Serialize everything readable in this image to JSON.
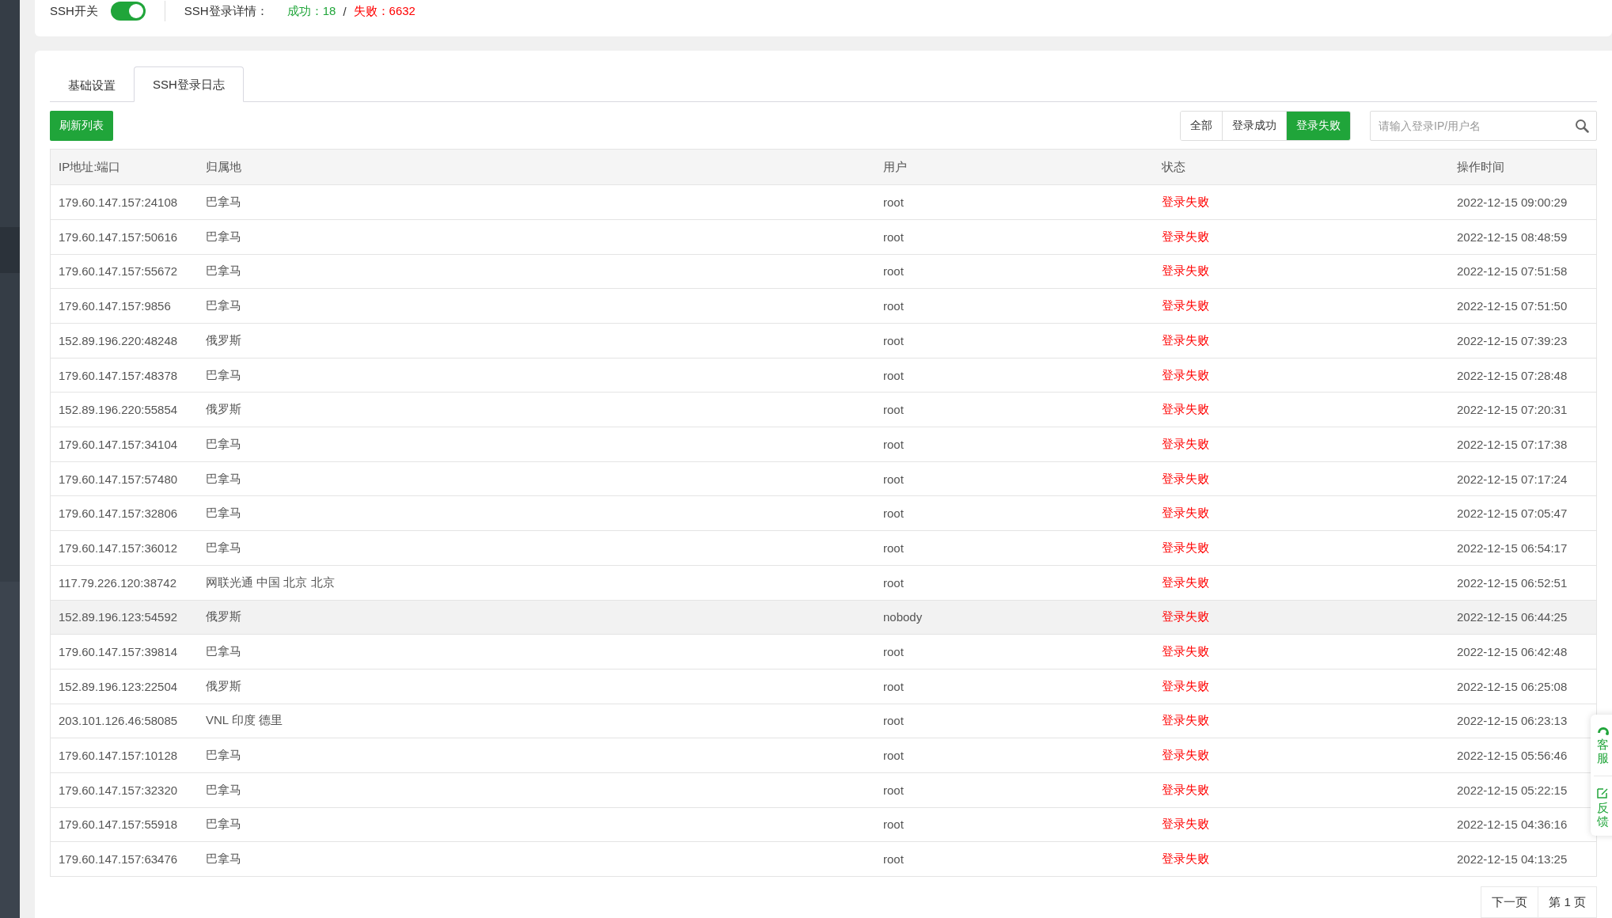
{
  "header": {
    "switch_label": "SSH开关",
    "switch_on": true,
    "details_label": "SSH登录详情：",
    "success": "成功：18",
    "separator": "/",
    "failure": "失败：6632"
  },
  "tabs": [
    {
      "label": "基础设置",
      "selected": false
    },
    {
      "label": "SSH登录日志",
      "selected": true
    }
  ],
  "refresh_button": "刷新列表",
  "filters": [
    {
      "label": "全部",
      "selected": false
    },
    {
      "label": "登录成功",
      "selected": false
    },
    {
      "label": "登录失败",
      "selected": true
    }
  ],
  "search": {
    "placeholder": "请输入登录IP/用户名"
  },
  "table": {
    "columns": [
      "IP地址:端口",
      "归属地",
      "用户",
      "状态",
      "操作时间"
    ],
    "rows": [
      {
        "ip": "179.60.147.157:24108",
        "location": "巴拿马",
        "user": "root",
        "status": "登录失败",
        "failed": true,
        "time": "2022-12-15 09:00:29",
        "highlighted": false
      },
      {
        "ip": "179.60.147.157:50616",
        "location": "巴拿马",
        "user": "root",
        "status": "登录失败",
        "failed": true,
        "time": "2022-12-15 08:48:59",
        "highlighted": false
      },
      {
        "ip": "179.60.147.157:55672",
        "location": "巴拿马",
        "user": "root",
        "status": "登录失败",
        "failed": true,
        "time": "2022-12-15 07:51:58",
        "highlighted": false
      },
      {
        "ip": "179.60.147.157:9856",
        "location": "巴拿马",
        "user": "root",
        "status": "登录失败",
        "failed": true,
        "time": "2022-12-15 07:51:50",
        "highlighted": false
      },
      {
        "ip": "152.89.196.220:48248",
        "location": "俄罗斯",
        "user": "root",
        "status": "登录失败",
        "failed": true,
        "time": "2022-12-15 07:39:23",
        "highlighted": false
      },
      {
        "ip": "179.60.147.157:48378",
        "location": "巴拿马",
        "user": "root",
        "status": "登录失败",
        "failed": true,
        "time": "2022-12-15 07:28:48",
        "highlighted": false
      },
      {
        "ip": "152.89.196.220:55854",
        "location": "俄罗斯",
        "user": "root",
        "status": "登录失败",
        "failed": true,
        "time": "2022-12-15 07:20:31",
        "highlighted": false
      },
      {
        "ip": "179.60.147.157:34104",
        "location": "巴拿马",
        "user": "root",
        "status": "登录失败",
        "failed": true,
        "time": "2022-12-15 07:17:38",
        "highlighted": false
      },
      {
        "ip": "179.60.147.157:57480",
        "location": "巴拿马",
        "user": "root",
        "status": "登录失败",
        "failed": true,
        "time": "2022-12-15 07:17:24",
        "highlighted": false
      },
      {
        "ip": "179.60.147.157:32806",
        "location": "巴拿马",
        "user": "root",
        "status": "登录失败",
        "failed": true,
        "time": "2022-12-15 07:05:47",
        "highlighted": false
      },
      {
        "ip": "179.60.147.157:36012",
        "location": "巴拿马",
        "user": "root",
        "status": "登录失败",
        "failed": true,
        "time": "2022-12-15 06:54:17",
        "highlighted": false
      },
      {
        "ip": "117.79.226.120:38742",
        "location": "网联光通 中国 北京 北京",
        "user": "root",
        "status": "登录失败",
        "failed": true,
        "time": "2022-12-15 06:52:51",
        "highlighted": false
      },
      {
        "ip": "152.89.196.123:54592",
        "location": "俄罗斯",
        "user": "nobody",
        "status": "登录失败",
        "failed": true,
        "time": "2022-12-15 06:44:25",
        "highlighted": true
      },
      {
        "ip": "179.60.147.157:39814",
        "location": "巴拿马",
        "user": "root",
        "status": "登录失败",
        "failed": true,
        "time": "2022-12-15 06:42:48",
        "highlighted": false
      },
      {
        "ip": "152.89.196.123:22504",
        "location": "俄罗斯",
        "user": "root",
        "status": "登录失败",
        "failed": true,
        "time": "2022-12-15 06:25:08",
        "highlighted": false
      },
      {
        "ip": "203.101.126.46:58085",
        "location": "VNL 印度 德里",
        "user": "root",
        "status": "登录失败",
        "failed": true,
        "time": "2022-12-15 06:23:13",
        "highlighted": false
      },
      {
        "ip": "179.60.147.157:10128",
        "location": "巴拿马",
        "user": "root",
        "status": "登录失败",
        "failed": true,
        "time": "2022-12-15 05:56:46",
        "highlighted": false
      },
      {
        "ip": "179.60.147.157:32320",
        "location": "巴拿马",
        "user": "root",
        "status": "登录失败",
        "failed": true,
        "time": "2022-12-15 05:22:15",
        "highlighted": false
      },
      {
        "ip": "179.60.147.157:55918",
        "location": "巴拿马",
        "user": "root",
        "status": "登录失败",
        "failed": true,
        "time": "2022-12-15 04:36:16",
        "highlighted": false
      },
      {
        "ip": "179.60.147.157:63476",
        "location": "巴拿马",
        "user": "root",
        "status": "登录失败",
        "failed": true,
        "time": "2022-12-15 04:13:25",
        "highlighted": false
      }
    ]
  },
  "pagination": [
    "下一页",
    "第 1 页"
  ],
  "float_panel": [
    {
      "kind": "service",
      "label": "客服"
    },
    {
      "kind": "feedback",
      "label": "反馈"
    }
  ]
}
